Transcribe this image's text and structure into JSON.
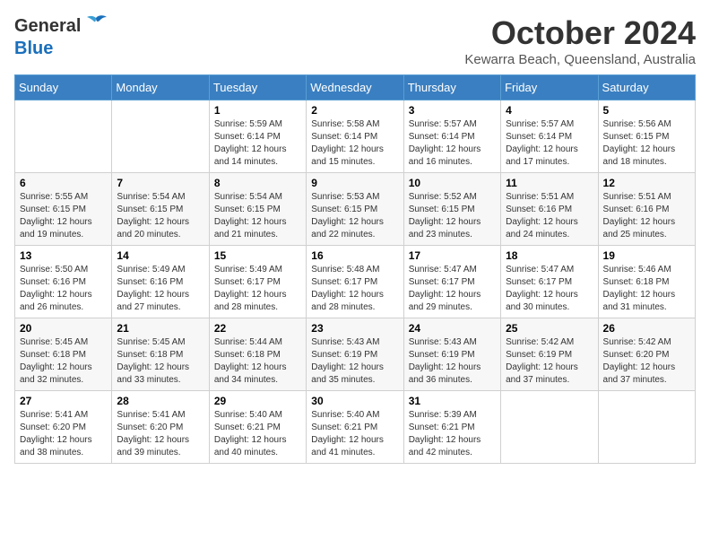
{
  "header": {
    "logo_general": "General",
    "logo_blue": "Blue",
    "month_title": "October 2024",
    "location": "Kewarra Beach, Queensland, Australia"
  },
  "days_of_week": [
    "Sunday",
    "Monday",
    "Tuesday",
    "Wednesday",
    "Thursday",
    "Friday",
    "Saturday"
  ],
  "weeks": [
    [
      {
        "day": "",
        "sunrise": "",
        "sunset": "",
        "daylight": ""
      },
      {
        "day": "",
        "sunrise": "",
        "sunset": "",
        "daylight": ""
      },
      {
        "day": "1",
        "sunrise": "Sunrise: 5:59 AM",
        "sunset": "Sunset: 6:14 PM",
        "daylight": "Daylight: 12 hours and 14 minutes."
      },
      {
        "day": "2",
        "sunrise": "Sunrise: 5:58 AM",
        "sunset": "Sunset: 6:14 PM",
        "daylight": "Daylight: 12 hours and 15 minutes."
      },
      {
        "day": "3",
        "sunrise": "Sunrise: 5:57 AM",
        "sunset": "Sunset: 6:14 PM",
        "daylight": "Daylight: 12 hours and 16 minutes."
      },
      {
        "day": "4",
        "sunrise": "Sunrise: 5:57 AM",
        "sunset": "Sunset: 6:14 PM",
        "daylight": "Daylight: 12 hours and 17 minutes."
      },
      {
        "day": "5",
        "sunrise": "Sunrise: 5:56 AM",
        "sunset": "Sunset: 6:15 PM",
        "daylight": "Daylight: 12 hours and 18 minutes."
      }
    ],
    [
      {
        "day": "6",
        "sunrise": "Sunrise: 5:55 AM",
        "sunset": "Sunset: 6:15 PM",
        "daylight": "Daylight: 12 hours and 19 minutes."
      },
      {
        "day": "7",
        "sunrise": "Sunrise: 5:54 AM",
        "sunset": "Sunset: 6:15 PM",
        "daylight": "Daylight: 12 hours and 20 minutes."
      },
      {
        "day": "8",
        "sunrise": "Sunrise: 5:54 AM",
        "sunset": "Sunset: 6:15 PM",
        "daylight": "Daylight: 12 hours and 21 minutes."
      },
      {
        "day": "9",
        "sunrise": "Sunrise: 5:53 AM",
        "sunset": "Sunset: 6:15 PM",
        "daylight": "Daylight: 12 hours and 22 minutes."
      },
      {
        "day": "10",
        "sunrise": "Sunrise: 5:52 AM",
        "sunset": "Sunset: 6:15 PM",
        "daylight": "Daylight: 12 hours and 23 minutes."
      },
      {
        "day": "11",
        "sunrise": "Sunrise: 5:51 AM",
        "sunset": "Sunset: 6:16 PM",
        "daylight": "Daylight: 12 hours and 24 minutes."
      },
      {
        "day": "12",
        "sunrise": "Sunrise: 5:51 AM",
        "sunset": "Sunset: 6:16 PM",
        "daylight": "Daylight: 12 hours and 25 minutes."
      }
    ],
    [
      {
        "day": "13",
        "sunrise": "Sunrise: 5:50 AM",
        "sunset": "Sunset: 6:16 PM",
        "daylight": "Daylight: 12 hours and 26 minutes."
      },
      {
        "day": "14",
        "sunrise": "Sunrise: 5:49 AM",
        "sunset": "Sunset: 6:16 PM",
        "daylight": "Daylight: 12 hours and 27 minutes."
      },
      {
        "day": "15",
        "sunrise": "Sunrise: 5:49 AM",
        "sunset": "Sunset: 6:17 PM",
        "daylight": "Daylight: 12 hours and 28 minutes."
      },
      {
        "day": "16",
        "sunrise": "Sunrise: 5:48 AM",
        "sunset": "Sunset: 6:17 PM",
        "daylight": "Daylight: 12 hours and 28 minutes."
      },
      {
        "day": "17",
        "sunrise": "Sunrise: 5:47 AM",
        "sunset": "Sunset: 6:17 PM",
        "daylight": "Daylight: 12 hours and 29 minutes."
      },
      {
        "day": "18",
        "sunrise": "Sunrise: 5:47 AM",
        "sunset": "Sunset: 6:17 PM",
        "daylight": "Daylight: 12 hours and 30 minutes."
      },
      {
        "day": "19",
        "sunrise": "Sunrise: 5:46 AM",
        "sunset": "Sunset: 6:18 PM",
        "daylight": "Daylight: 12 hours and 31 minutes."
      }
    ],
    [
      {
        "day": "20",
        "sunrise": "Sunrise: 5:45 AM",
        "sunset": "Sunset: 6:18 PM",
        "daylight": "Daylight: 12 hours and 32 minutes."
      },
      {
        "day": "21",
        "sunrise": "Sunrise: 5:45 AM",
        "sunset": "Sunset: 6:18 PM",
        "daylight": "Daylight: 12 hours and 33 minutes."
      },
      {
        "day": "22",
        "sunrise": "Sunrise: 5:44 AM",
        "sunset": "Sunset: 6:18 PM",
        "daylight": "Daylight: 12 hours and 34 minutes."
      },
      {
        "day": "23",
        "sunrise": "Sunrise: 5:43 AM",
        "sunset": "Sunset: 6:19 PM",
        "daylight": "Daylight: 12 hours and 35 minutes."
      },
      {
        "day": "24",
        "sunrise": "Sunrise: 5:43 AM",
        "sunset": "Sunset: 6:19 PM",
        "daylight": "Daylight: 12 hours and 36 minutes."
      },
      {
        "day": "25",
        "sunrise": "Sunrise: 5:42 AM",
        "sunset": "Sunset: 6:19 PM",
        "daylight": "Daylight: 12 hours and 37 minutes."
      },
      {
        "day": "26",
        "sunrise": "Sunrise: 5:42 AM",
        "sunset": "Sunset: 6:20 PM",
        "daylight": "Daylight: 12 hours and 37 minutes."
      }
    ],
    [
      {
        "day": "27",
        "sunrise": "Sunrise: 5:41 AM",
        "sunset": "Sunset: 6:20 PM",
        "daylight": "Daylight: 12 hours and 38 minutes."
      },
      {
        "day": "28",
        "sunrise": "Sunrise: 5:41 AM",
        "sunset": "Sunset: 6:20 PM",
        "daylight": "Daylight: 12 hours and 39 minutes."
      },
      {
        "day": "29",
        "sunrise": "Sunrise: 5:40 AM",
        "sunset": "Sunset: 6:21 PM",
        "daylight": "Daylight: 12 hours and 40 minutes."
      },
      {
        "day": "30",
        "sunrise": "Sunrise: 5:40 AM",
        "sunset": "Sunset: 6:21 PM",
        "daylight": "Daylight: 12 hours and 41 minutes."
      },
      {
        "day": "31",
        "sunrise": "Sunrise: 5:39 AM",
        "sunset": "Sunset: 6:21 PM",
        "daylight": "Daylight: 12 hours and 42 minutes."
      },
      {
        "day": "",
        "sunrise": "",
        "sunset": "",
        "daylight": ""
      },
      {
        "day": "",
        "sunrise": "",
        "sunset": "",
        "daylight": ""
      }
    ]
  ]
}
